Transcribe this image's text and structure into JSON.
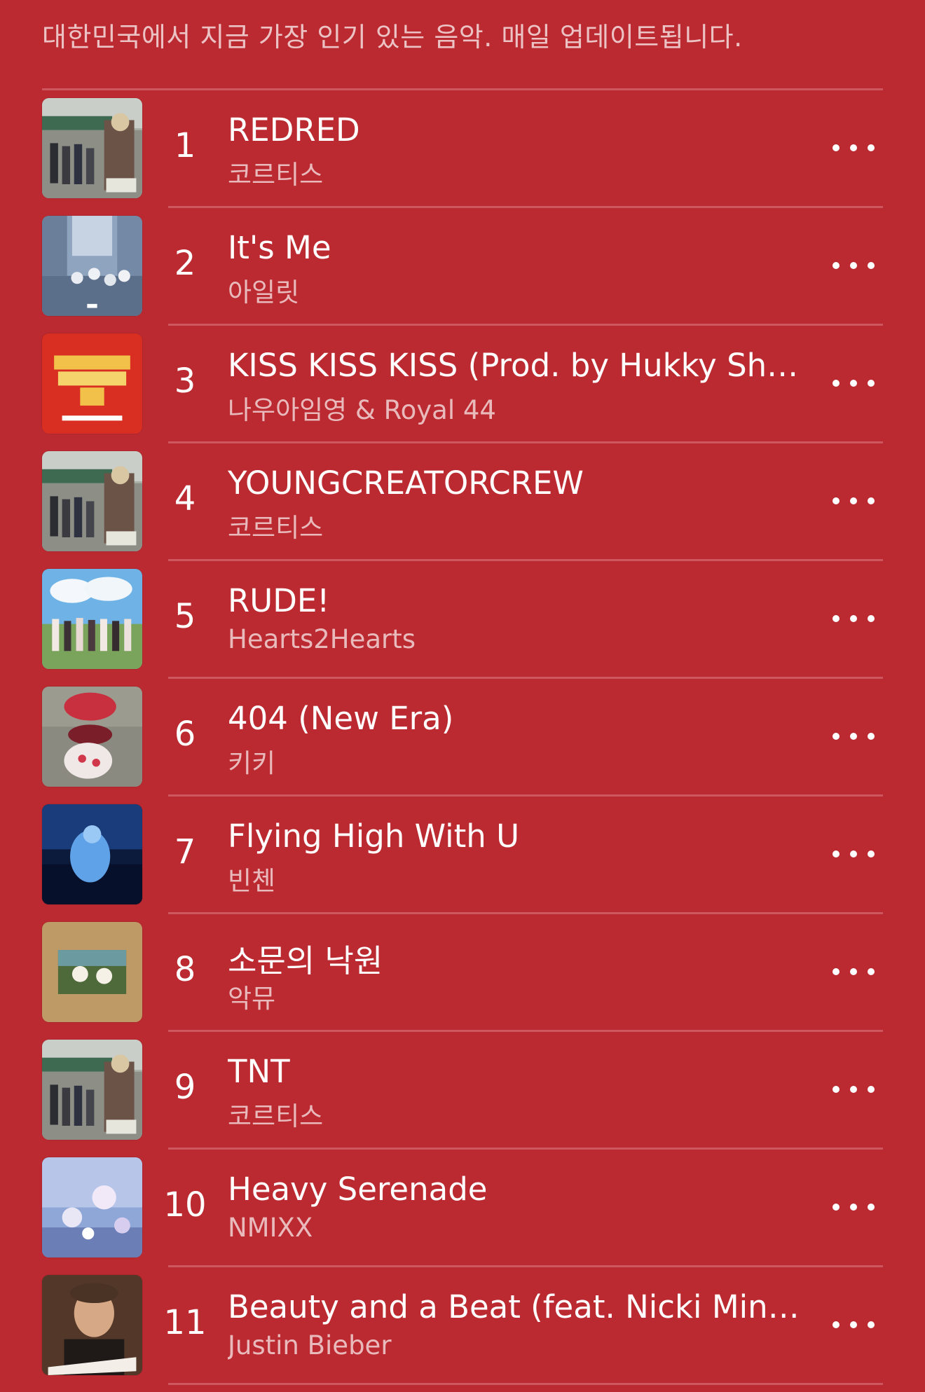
{
  "header": {
    "subtitle": "대한민국에서 지금 가장 인기 있는 음악. 매일 업데이트됩니다."
  },
  "colors": {
    "background": "#bc2a31",
    "text": "#ffffff"
  },
  "tracks": [
    {
      "rank": "1",
      "title": "REDRED",
      "artist": "코르티스",
      "artwork_icon": "group-photo-artwork"
    },
    {
      "rank": "2",
      "title": "It's Me",
      "artist": "아일릿",
      "artwork_icon": "street-scene-artwork"
    },
    {
      "rank": "3",
      "title": "KISS KISS KISS (Prod. by Hukky Shibaseki)",
      "artist": "나우아임영 & Royal 44",
      "artwork_icon": "show-logo-artwork"
    },
    {
      "rank": "4",
      "title": "YOUNGCREATORCREW",
      "artist": "코르티스",
      "artwork_icon": "group-photo-artwork"
    },
    {
      "rank": "5",
      "title": "RUDE!",
      "artist": "Hearts2Hearts",
      "artwork_icon": "sky-group-artwork"
    },
    {
      "rank": "6",
      "title": "404 (New Era)",
      "artist": "키키",
      "artwork_icon": "hats-artwork"
    },
    {
      "rank": "7",
      "title": "Flying High With U",
      "artist": "빈첸",
      "artwork_icon": "night-blue-artwork"
    },
    {
      "rank": "8",
      "title": "소문의 낙원",
      "artist": "악뮤",
      "artwork_icon": "flowers-frame-artwork"
    },
    {
      "rank": "9",
      "title": "TNT",
      "artist": "코르티스",
      "artwork_icon": "group-photo-artwork"
    },
    {
      "rank": "10",
      "title": "Heavy Serenade",
      "artist": "NMIXX",
      "artwork_icon": "flower-dream-artwork"
    },
    {
      "rank": "11",
      "title": "Beauty and a Beat (feat. Nicki Minaj)",
      "artist": "Justin Bieber",
      "artwork_icon": "portrait-artwork"
    }
  ]
}
